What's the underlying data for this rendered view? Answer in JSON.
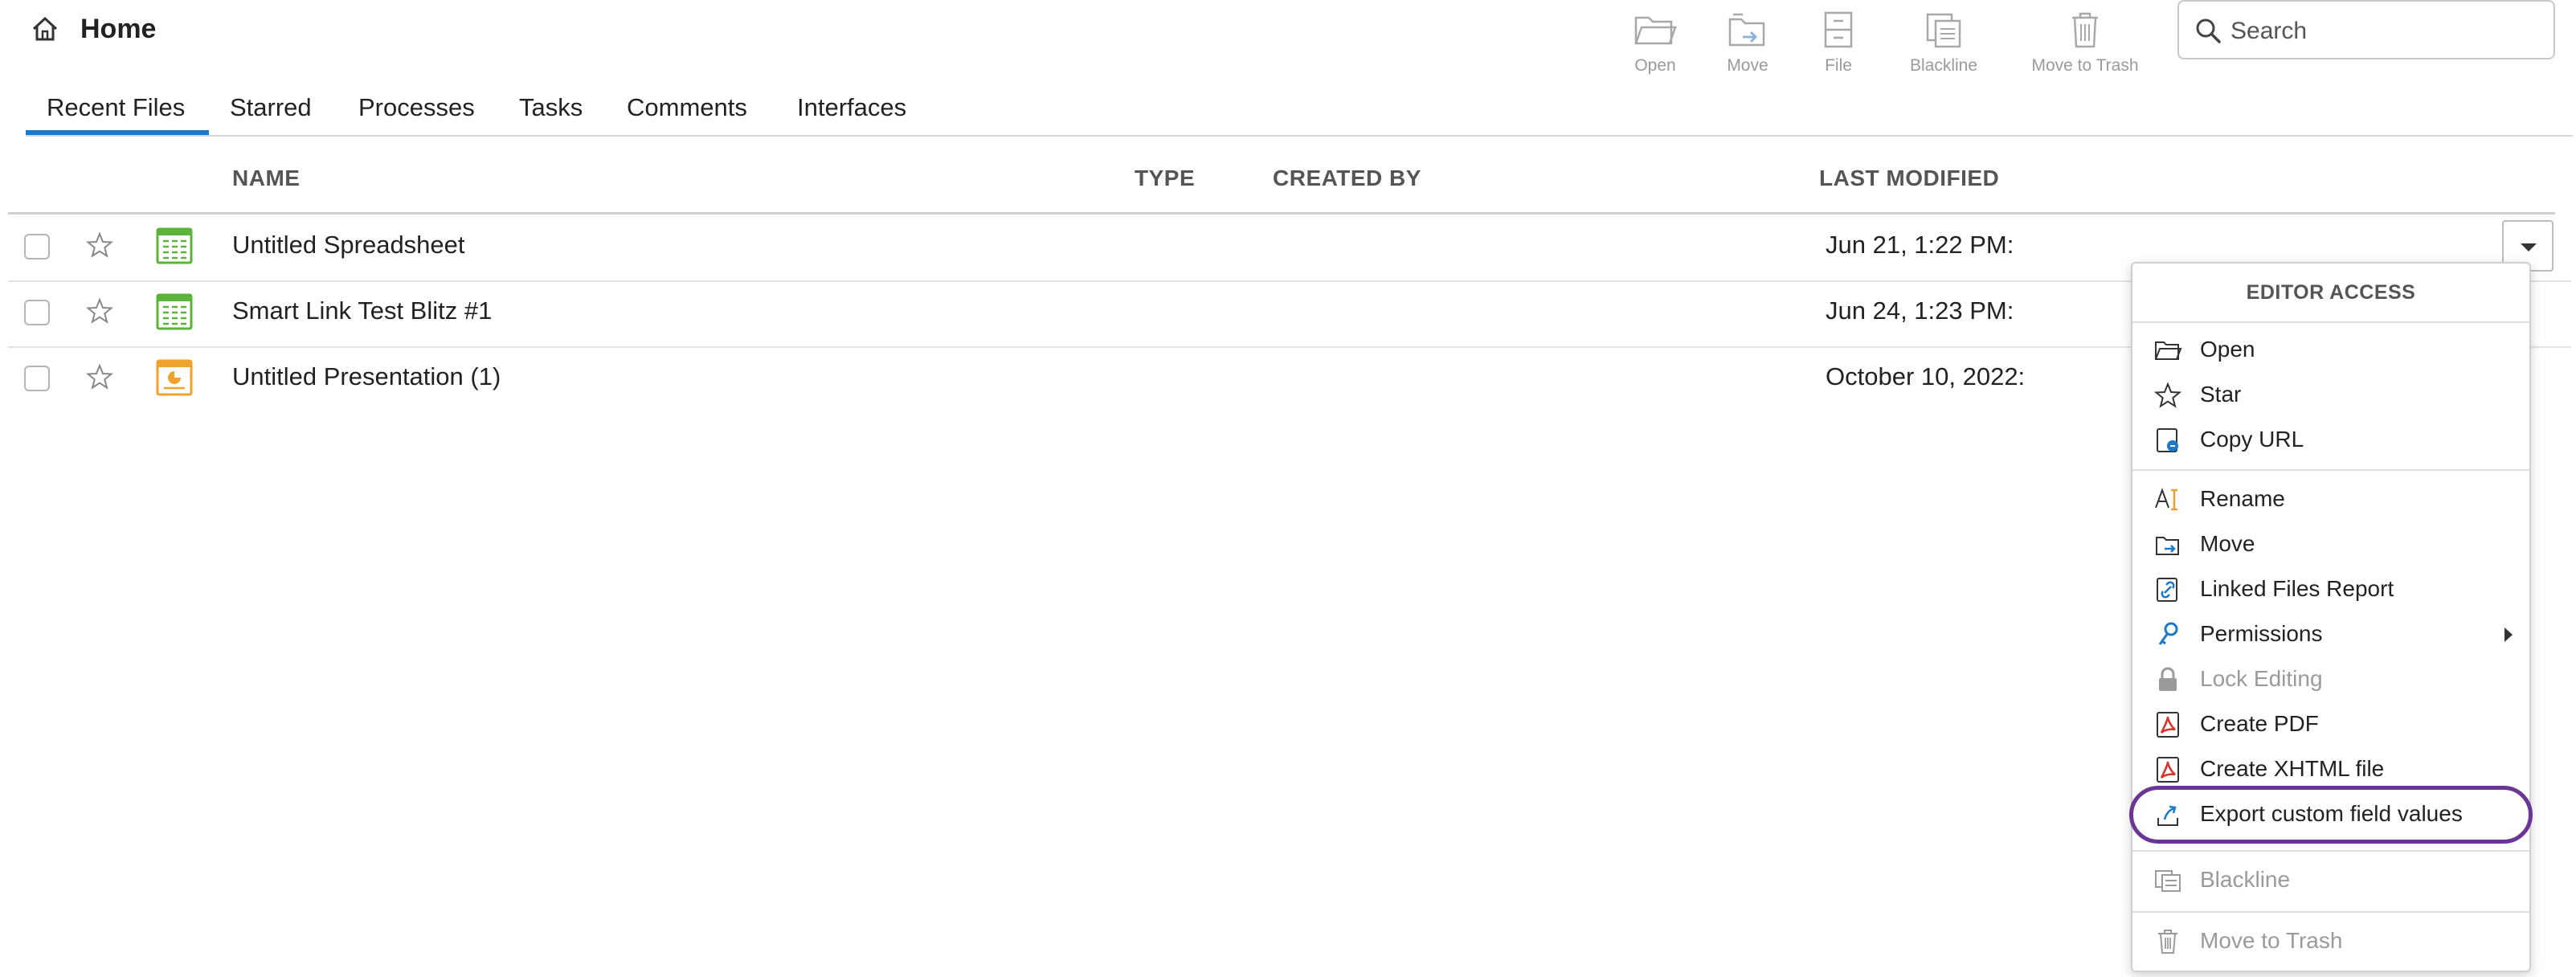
{
  "header": {
    "title": "Home",
    "toolbar": [
      {
        "label": "Open",
        "icon": "folder-open-icon"
      },
      {
        "label": "Move",
        "icon": "move-icon"
      },
      {
        "label": "File",
        "icon": "file-cabinet-icon"
      },
      {
        "label": "Blackline",
        "icon": "blackline-icon"
      },
      {
        "label": "Move to Trash",
        "icon": "trash-icon"
      }
    ],
    "search": {
      "placeholder": "Search",
      "value": ""
    }
  },
  "tabs": [
    {
      "label": "Recent Files",
      "active": true
    },
    {
      "label": "Starred"
    },
    {
      "label": "Processes"
    },
    {
      "label": "Tasks"
    },
    {
      "label": "Comments"
    },
    {
      "label": "Interfaces"
    }
  ],
  "table": {
    "columns": [
      "NAME",
      "TYPE",
      "CREATED BY",
      "LAST MODIFIED"
    ],
    "rows": [
      {
        "name": "Untitled Spreadsheet",
        "type": "spreadsheet",
        "modified": "Jun 21, 1:22 PM:"
      },
      {
        "name": "Smart Link Test Blitz #1",
        "type": "spreadsheet",
        "modified": "Jun 24, 1:23 PM:"
      },
      {
        "name": "Untitled Presentation (1)",
        "type": "presentation",
        "modified": "October 10, 2022:"
      }
    ]
  },
  "context_menu": {
    "header": "EDITOR ACCESS",
    "groups": [
      [
        {
          "label": "Open",
          "icon": "folder-open-icon"
        },
        {
          "label": "Star",
          "icon": "star-icon"
        },
        {
          "label": "Copy URL",
          "icon": "copy-url-icon"
        }
      ],
      [
        {
          "label": "Rename",
          "icon": "rename-icon"
        },
        {
          "label": "Move",
          "icon": "move-icon"
        },
        {
          "label": "Linked Files Report",
          "icon": "linked-files-icon"
        },
        {
          "label": "Permissions",
          "icon": "key-icon",
          "submenu": true
        },
        {
          "label": "Lock Editing",
          "icon": "lock-icon",
          "disabled": true
        },
        {
          "label": "Create PDF",
          "icon": "pdf-icon"
        },
        {
          "label": "Create XHTML file",
          "icon": "pdf-icon"
        },
        {
          "label": "Export custom field values",
          "icon": "export-icon",
          "highlighted": true
        }
      ],
      [
        {
          "label": "Blackline",
          "icon": "blackline-icon",
          "disabled": true
        }
      ],
      [
        {
          "label": "Move to Trash",
          "icon": "trash-icon",
          "disabled": true
        }
      ]
    ]
  },
  "colors": {
    "accent": "#1b79c9",
    "highlight": "#6a3595",
    "spreadsheet": "#5bb33a",
    "presentation": "#f0a22e",
    "pdf": "#d8332a"
  }
}
